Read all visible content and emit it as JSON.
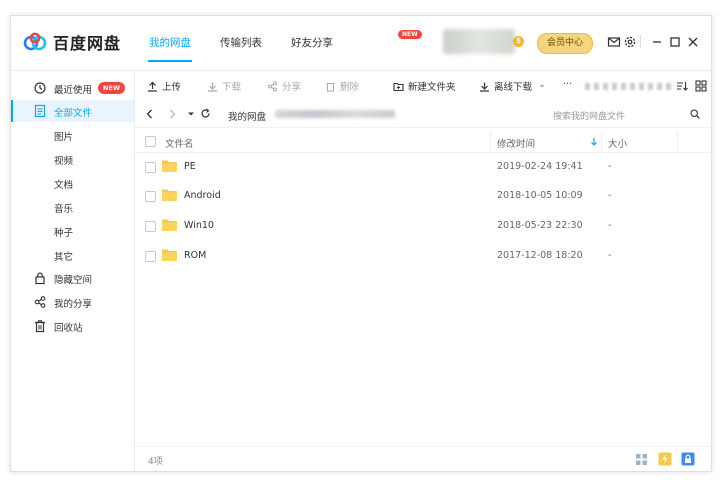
{
  "app": {
    "name": "百度网盘"
  },
  "header": {
    "tabs": [
      {
        "label": "我的网盘"
      },
      {
        "label": "传输列表"
      },
      {
        "label": "好友分享"
      }
    ],
    "new_badge": "NEW",
    "vip_label": "会员中心",
    "coin_symbol": "$"
  },
  "sidebar": {
    "items": [
      {
        "label": "最近使用",
        "badge": "NEW"
      },
      {
        "label": "全部文件"
      },
      {
        "label": "隐藏空间"
      },
      {
        "label": "我的分享"
      },
      {
        "label": "回收站"
      }
    ],
    "subitems": [
      "图片",
      "视频",
      "文档",
      "音乐",
      "种子",
      "其它"
    ]
  },
  "toolbar": {
    "upload": "上传",
    "download": "下载",
    "share": "分享",
    "delete": "删除",
    "new_folder": "新建文件夹",
    "offline_download": "离线下载",
    "more": "···"
  },
  "pathbar": {
    "root": "我的网盘",
    "search_placeholder": "搜索我的网盘文件"
  },
  "table": {
    "headers": {
      "name": "文件名",
      "modified": "修改时间",
      "size": "大小"
    },
    "rows": [
      {
        "name": "PE",
        "modified": "2019-02-24 19:41",
        "size": "-"
      },
      {
        "name": "Android",
        "modified": "2018-10-05 10:09",
        "size": "-"
      },
      {
        "name": "Win10",
        "modified": "2018-05-23 22:30",
        "size": "-"
      },
      {
        "name": "ROM",
        "modified": "2017-12-08 18:20",
        "size": "-"
      }
    ]
  },
  "footer": {
    "count": "4项"
  },
  "colors": {
    "accent": "#06a7ff",
    "folder": "#f5c94c",
    "badge": "#f2453d",
    "vip": "#f7d47e"
  }
}
